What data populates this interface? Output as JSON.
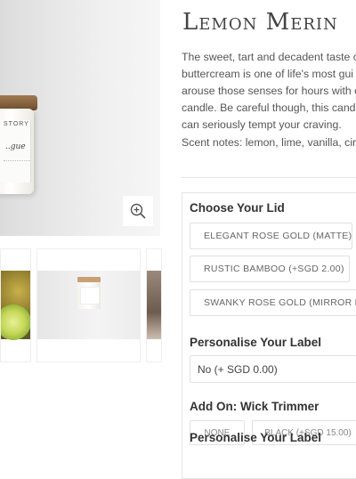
{
  "product": {
    "title": "Lemon Merin",
    "description_lines": [
      "The sweet, tart and decadent taste o",
      "buttercream is one of life's most gui",
      "arouse those senses for hours with c",
      "candle. Be careful though, this candl",
      "can seriously tempt your craving."
    ],
    "scent_notes": "Scent notes: lemon, lime, vanilla, cir"
  },
  "gallery": {
    "jar_brand": "STORY",
    "jar_script": "..gue",
    "zoom_icon": "zoom-in-icon"
  },
  "options": {
    "lid": {
      "label": "Choose Your Lid",
      "choices": [
        "ELEGANT ROSE GOLD (MATTE)",
        "RUSTIC BAMBOO (+SGD 2.00)",
        "SWANKY ROSE GOLD (MIRROR FIN"
      ]
    },
    "label_personalise": {
      "label": "Personalise Your Label",
      "selected": "No (+ SGD 0.00)"
    },
    "wick_trimmer": {
      "label": "Add On: Wick Trimmer",
      "choices": [
        "NONE",
        "BLACK (+SGD 15.00)"
      ]
    },
    "sticky_label": "Personalise Your Label"
  }
}
